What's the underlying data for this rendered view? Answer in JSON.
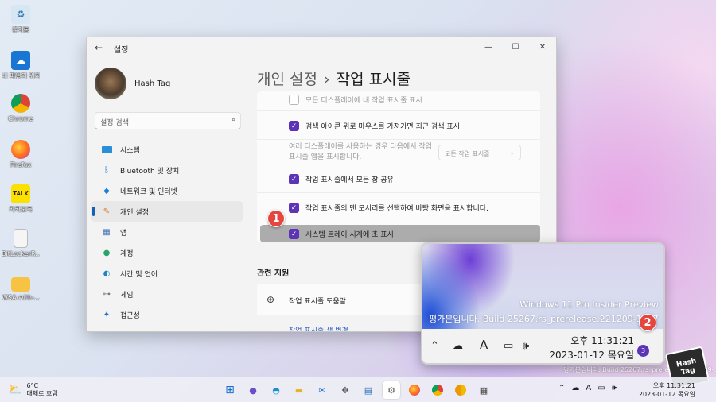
{
  "desktop": {
    "icons": [
      {
        "label": "휴지통",
        "icon": "recycle-bin-icon"
      },
      {
        "label": "내 파일의 위치",
        "icon": "onedrive-icon"
      },
      {
        "label": "Chrome",
        "icon": "chrome-icon"
      },
      {
        "label": "Firefox",
        "icon": "firefox-icon"
      },
      {
        "label": "카카오톡",
        "icon": "kakaotalk-icon"
      },
      {
        "label": "BitLockerR...",
        "icon": "document-icon"
      },
      {
        "label": "WSA with-...",
        "icon": "folder-icon"
      }
    ],
    "watermark": "평가본입니다. Build 25267.rs_prerelease.221209-..."
  },
  "settings": {
    "title": "설정",
    "window_controls": {
      "minimize": "—",
      "maximize": "☐",
      "close": "✕"
    },
    "user_name": "Hash Tag",
    "search_placeholder": "설정 검색",
    "nav": [
      {
        "label": "시스템",
        "icon": "system-icon"
      },
      {
        "label": "Bluetooth 및 장치",
        "icon": "bluetooth-icon"
      },
      {
        "label": "네트워크 및 인터넷",
        "icon": "network-icon"
      },
      {
        "label": "개인 설정",
        "icon": "personalization-icon",
        "active": true
      },
      {
        "label": "앱",
        "icon": "apps-icon"
      },
      {
        "label": "계정",
        "icon": "accounts-icon"
      },
      {
        "label": "시간 및 언어",
        "icon": "time-language-icon"
      },
      {
        "label": "게임",
        "icon": "gaming-icon"
      },
      {
        "label": "접근성",
        "icon": "accessibility-icon"
      }
    ],
    "breadcrumb": {
      "parent": "개인 설정",
      "separator": "›",
      "current": "작업 표시줄"
    },
    "options": [
      {
        "label": "모든 디스플레이에 내 작업 표시줄 표시",
        "checked": false,
        "disabled": true
      },
      {
        "label": "검색 아이콘 위로 마우스를 가져가면 최근 검색 표시",
        "checked": true
      },
      {
        "label": "작업 표시줄에서 모든 창 공유",
        "checked": true
      },
      {
        "label": "작업 표시줄의 맨 모서리를 선택하여 바탕 화면을 표시합니다.",
        "checked": true
      },
      {
        "label": "시스템 트레이 시계에 초 표시",
        "checked": true,
        "highlighted": true
      }
    ],
    "multi_display": {
      "label": "여러 디스플레이를 사용하는 경우 다음에서 작업 표시줄 앱을 표시합니다.",
      "dropdown_value": "모든 작업 표시줄"
    },
    "related_title": "관련 지원",
    "related_item": "작업 표시줄 도움말",
    "related_link": "작업 표시줄 색 변경"
  },
  "badges": {
    "one": "1",
    "two": "2"
  },
  "zoom": {
    "watermark_line1": "Windows 11 Pro Insider Preview",
    "watermark_line2": "평가본입니다. Build 25267.rs_prerelease.221209-1617",
    "time": "오후 11:31:21",
    "date": "2023-01-12 목요일",
    "notifications": "3"
  },
  "taskbar": {
    "weather_temp": "6°C",
    "weather_desc": "대체로 흐림",
    "apps": [
      "windows-start-icon",
      "teams-chat-icon",
      "edge-icon",
      "file-explorer-icon",
      "mail-icon",
      "move-icon",
      "notepad-icon",
      "settings-icon",
      "firefox-icon",
      "chrome-icon",
      "chrome-canary-icon",
      "calculator-icon"
    ],
    "clock_time": "오후 11:31:21",
    "clock_date": "2023-01-12 목요일"
  },
  "logo": {
    "line1": "Hash",
    "line2": "Tag"
  },
  "colors": {
    "accent": "#5b35b5",
    "badge": "#e5463f",
    "link": "#2a5fbf"
  }
}
